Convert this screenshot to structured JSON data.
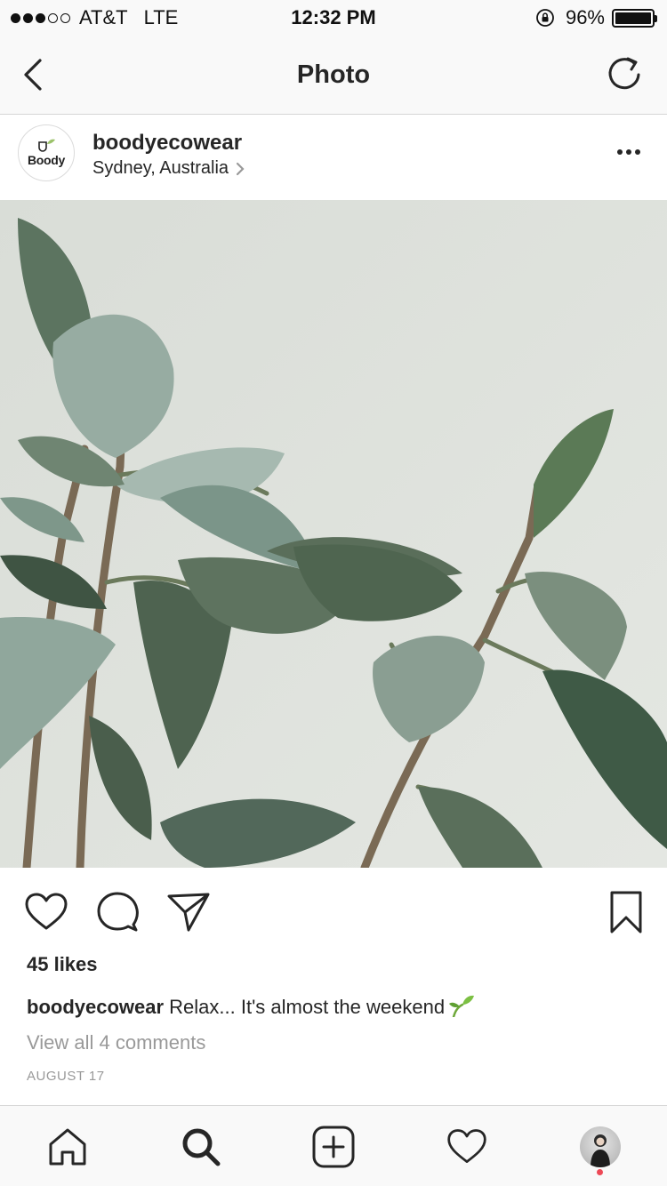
{
  "status_bar": {
    "carrier": "AT&T",
    "network": "LTE",
    "time": "12:32 PM",
    "battery": "96%",
    "battery_level": 0.96
  },
  "nav": {
    "title": "Photo",
    "back_icon": "chevron-left-icon",
    "refresh_icon": "refresh-icon"
  },
  "post": {
    "username": "boodyecowear",
    "avatar_logo_text": "Boody",
    "location": "Sydney, Australia",
    "likes": "45 likes",
    "caption_user": "boodyecowear",
    "caption_text": " Relax... It's almost the weekend",
    "caption_emoji": "seedling-emoji",
    "view_comments": "View all 4 comments",
    "date": "AUGUST 17"
  },
  "colors": {
    "text": "#262626",
    "muted": "#999999",
    "bar_bg": "#f9f9f9",
    "divider": "#d6d6d6",
    "notification": "#ed4956",
    "photo_bg": "#dde2dc",
    "leaf_dark": "#4d6451",
    "leaf_light": "#9fb3a6"
  },
  "tab_bar": {
    "items": [
      "home-icon",
      "search-icon",
      "add-post-icon",
      "activity-heart-icon",
      "profile-avatar"
    ]
  }
}
